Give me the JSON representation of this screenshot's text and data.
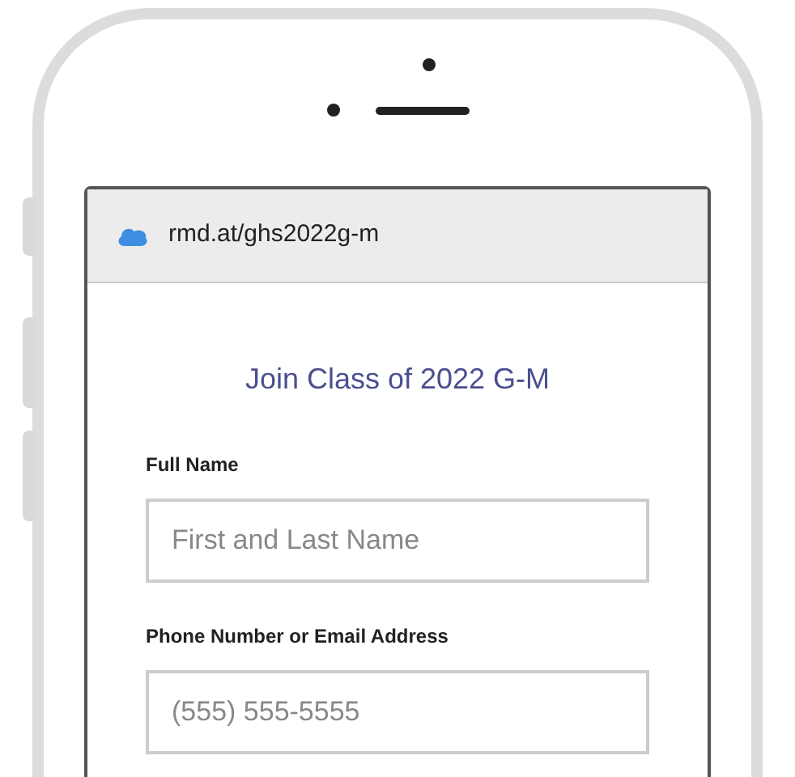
{
  "browser": {
    "url": "rmd.at/ghs2022g-m"
  },
  "form": {
    "title": "Join Class of 2022 G-M",
    "fields": [
      {
        "label": "Full Name",
        "placeholder": "First and Last Name"
      },
      {
        "label": "Phone Number or Email Address",
        "placeholder": "(555) 555-5555"
      }
    ]
  }
}
